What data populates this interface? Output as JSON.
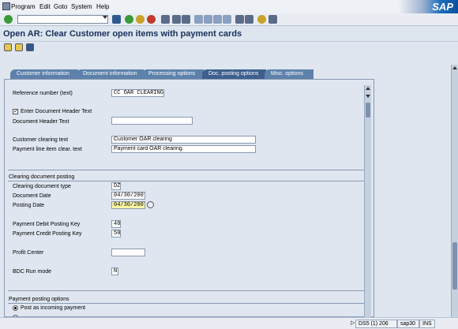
{
  "menu": {
    "items": [
      "Program",
      "Edit",
      "Goto",
      "System",
      "Help"
    ]
  },
  "logo": "SAP",
  "title": "Open AR: Clear Customer open items with payment cards",
  "tabs": [
    "Customer information",
    "Document information",
    "Processing options",
    "Doc. posting options",
    "Misc. options"
  ],
  "active_tab": "Doc. posting options",
  "form": {
    "reference_number_label": "Reference number (text)",
    "reference_number_value": "CC OAR CLEARING",
    "enter_doc_header_label": "Enter Document Header Text",
    "enter_doc_header_checked": "✓",
    "doc_header_text_label": "Document Header Text",
    "doc_header_text_value": "",
    "customer_clearing_label": "Customer clearing text",
    "customer_clearing_value": "Customer OAR clearing",
    "payment_line_label": "Payment line item clear. text",
    "payment_line_value": "Payment card OAR clearing"
  },
  "clearing": {
    "header": "Clearing document posting",
    "doc_type_label": "Clearing document type",
    "doc_type_value": "DZ",
    "doc_date_label": "Document Date",
    "doc_date_value": "04/30/2007",
    "posting_date_label": "Posting Date",
    "posting_date_value": "04/30/2007",
    "debit_key_label": "Payment Debit Posting Key",
    "debit_key_value": "40",
    "credit_key_label": "Payment Credit Posting Key",
    "credit_key_value": "50",
    "profit_center_label": "Profit Center",
    "profit_center_value": "",
    "bdc_label": "BDC Run mode",
    "bdc_value": "N"
  },
  "payment": {
    "header": "Payment posting options",
    "option1": "Post as incoming payment"
  },
  "status": {
    "system": "DS5 (1) 206",
    "server": "sap30",
    "mode": "INS"
  }
}
